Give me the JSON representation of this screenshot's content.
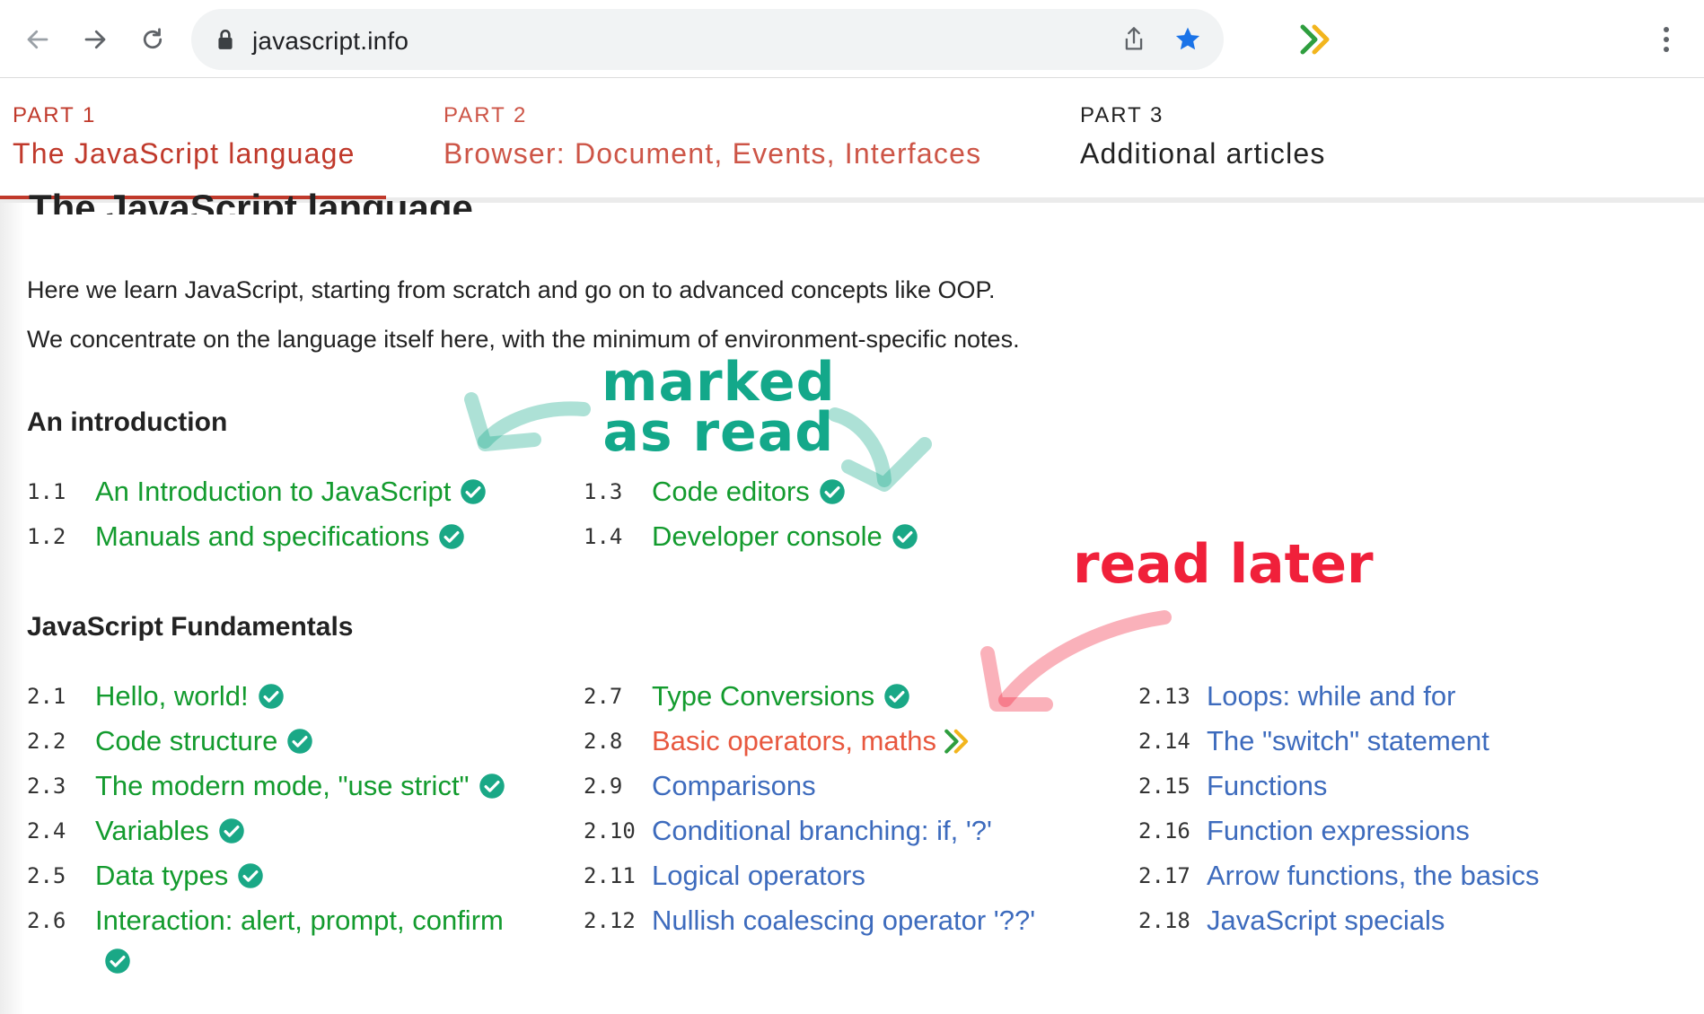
{
  "browser": {
    "url": "javascript.info",
    "back_icon": "arrow-left-icon",
    "forward_icon": "arrow-right-icon",
    "reload_icon": "reload-icon",
    "lock_icon": "lock-icon",
    "share_icon": "share-icon",
    "bookmark_icon": "star-icon",
    "extension_icon": "double-chevron-icon",
    "menu_icon": "kebab-menu-icon"
  },
  "parts": [
    {
      "number": "PART 1",
      "title": "The JavaScript language",
      "active": true
    },
    {
      "number": "PART 2",
      "title": "Browser: Document, Events, Interfaces",
      "active": false
    },
    {
      "number": "PART 3",
      "title": "Additional articles",
      "active": false
    }
  ],
  "page": {
    "heading": "The JavaScript language",
    "intro": [
      "Here we learn JavaScript, starting from scratch and go on to advanced concepts like OOP.",
      "We concentrate on the language itself here, with the minimum of environment-specific notes."
    ]
  },
  "sections": [
    {
      "title": "An introduction",
      "items": [
        {
          "num": "1.1",
          "label": "An Introduction to JavaScript",
          "status": "read"
        },
        {
          "num": "1.2",
          "label": "Manuals and specifications",
          "status": "read"
        },
        {
          "num": "1.3",
          "label": "Code editors",
          "status": "read"
        },
        {
          "num": "1.4",
          "label": "Developer console",
          "status": "read"
        }
      ]
    },
    {
      "title": "JavaScript Fundamentals",
      "items": [
        {
          "num": "2.1",
          "label": "Hello, world!",
          "status": "read"
        },
        {
          "num": "2.2",
          "label": "Code structure",
          "status": "read"
        },
        {
          "num": "2.3",
          "label": "The modern mode, \"use strict\"",
          "status": "read"
        },
        {
          "num": "2.4",
          "label": "Variables",
          "status": "read"
        },
        {
          "num": "2.5",
          "label": "Data types",
          "status": "read"
        },
        {
          "num": "2.6",
          "label": "Interaction: alert, prompt, confirm",
          "status": "read"
        },
        {
          "num": "2.7",
          "label": "Type Conversions",
          "status": "read"
        },
        {
          "num": "2.8",
          "label": "Basic operators, maths",
          "status": "read-later"
        },
        {
          "num": "2.9",
          "label": "Comparisons",
          "status": "unread"
        },
        {
          "num": "2.10",
          "label": "Conditional branching: if, '?'",
          "status": "unread"
        },
        {
          "num": "2.11",
          "label": "Logical operators",
          "status": "unread"
        },
        {
          "num": "2.12",
          "label": "Nullish coalescing operator '??'",
          "status": "unread"
        },
        {
          "num": "2.13",
          "label": "Loops: while and for",
          "status": "unread"
        },
        {
          "num": "2.14",
          "label": "The \"switch\" statement",
          "status": "unread"
        },
        {
          "num": "2.15",
          "label": "Functions",
          "status": "unread"
        },
        {
          "num": "2.16",
          "label": "Function expressions",
          "status": "unread"
        },
        {
          "num": "2.17",
          "label": "Arrow functions, the basics",
          "status": "unread"
        },
        {
          "num": "2.18",
          "label": "JavaScript specials",
          "status": "unread"
        }
      ]
    }
  ],
  "annotations": {
    "marked_line1": "marked",
    "marked_line2": "as read",
    "read_later": "read later"
  },
  "colors": {
    "accent": "#c0392b",
    "read": "#139b2e",
    "read_later": "#e8583f",
    "unread": "#3d6bbd",
    "check": "#1aa886",
    "annotation_green": "#13a88a",
    "annotation_red": "#f0203a"
  }
}
